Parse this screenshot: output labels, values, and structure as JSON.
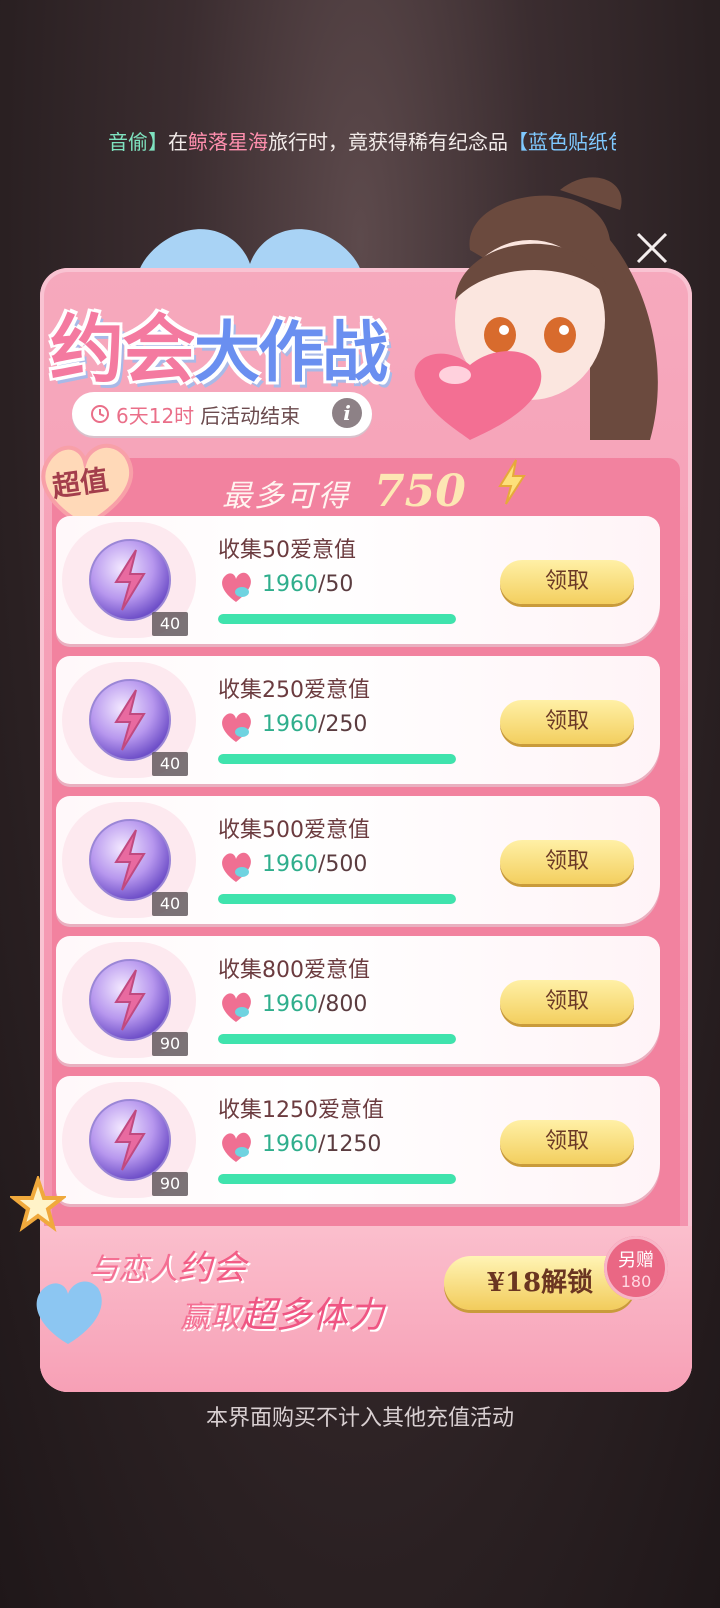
{
  "ticker": {
    "part1": "音偷】",
    "part2": "在",
    "place": "鲸落星海",
    "part3": "旅行时，竟获得稀有纪念品",
    "item": "【蓝色贴纸包"
  },
  "event": {
    "title_part1": "约会",
    "title_part2": "大作战",
    "timer_value": "6天12时",
    "timer_suffix": "后活动结束",
    "info_label": "i",
    "badge": "超值",
    "max_label": "最多可得",
    "max_value": "750"
  },
  "tasks": [
    {
      "title": "收集50爱意值",
      "current": "1960",
      "target": "/50",
      "reward_qty": "40",
      "claim_label": "领取",
      "progress": 1.0
    },
    {
      "title": "收集250爱意值",
      "current": "1960",
      "target": "/250",
      "reward_qty": "40",
      "claim_label": "领取",
      "progress": 1.0
    },
    {
      "title": "收集500爱意值",
      "current": "1960",
      "target": "/500",
      "reward_qty": "40",
      "claim_label": "领取",
      "progress": 1.0
    },
    {
      "title": "收集800爱意值",
      "current": "1960",
      "target": "/800",
      "reward_qty": "90",
      "claim_label": "领取",
      "progress": 1.0
    },
    {
      "title": "收集1250爱意值",
      "current": "1960",
      "target": "/1250",
      "reward_qty": "90",
      "claim_label": "领取",
      "progress": 1.0
    }
  ],
  "banner": {
    "slogan1_pre": "与恋人",
    "slogan1_em": "约会",
    "slogan2_pre": "赢取",
    "slogan2_em": "超多体力",
    "unlock_label": "¥18解锁",
    "bonus_label": "另赠",
    "bonus_value": "180"
  },
  "footer_note": "本界面购买不计入其他充值活动",
  "colors": {
    "accent_pink": "#f48fac",
    "progress_green": "#3fe3ad",
    "gold_button": "#f3cf5f"
  }
}
